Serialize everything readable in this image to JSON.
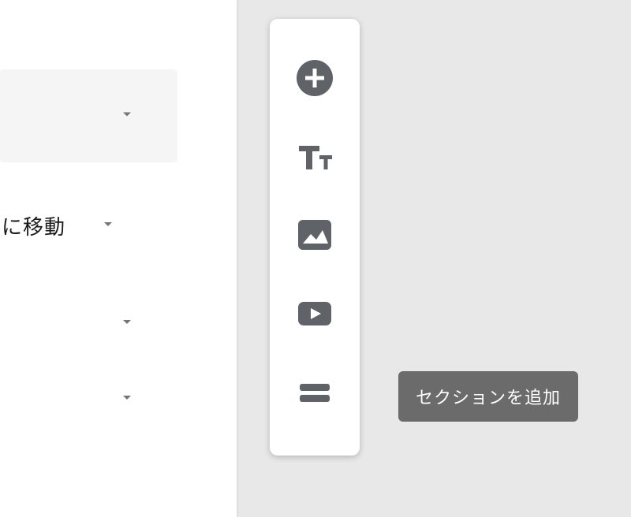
{
  "left_panel": {
    "move_label": "に移動"
  },
  "toolbar": {
    "add_question": "質問を追加",
    "add_title": "タイトルと説明を追加",
    "add_image": "画像を追加",
    "add_video": "動画を追加",
    "add_section": "セクションを追加"
  },
  "tooltip": {
    "text": "セクションを追加"
  },
  "colors": {
    "icon": "#5f6368",
    "tooltip_bg": "#6b6b6b"
  }
}
